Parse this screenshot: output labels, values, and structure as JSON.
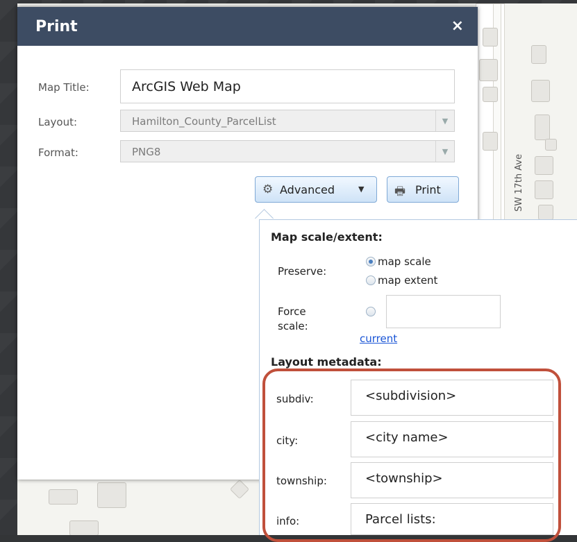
{
  "map": {
    "street_label": "SW 17th Ave"
  },
  "dialog": {
    "title": "Print",
    "close_glyph": "×",
    "map_title": {
      "label": "Map Title:",
      "value": "ArcGIS Web Map"
    },
    "layout": {
      "label": "Layout:",
      "value": "Hamilton_County_ParcelList"
    },
    "format": {
      "label": "Format:",
      "value": "PNG8"
    },
    "buttons": {
      "advanced": "Advanced",
      "print": "Print"
    }
  },
  "advanced_panel": {
    "scale_section": "Map scale/extent:",
    "preserve_label": "Preserve:",
    "preserve_options": [
      "map scale",
      "map extent"
    ],
    "preserve_selected": "map scale",
    "force_scale_label_line1": "Force",
    "force_scale_label_line2": "scale:",
    "force_scale_value": "",
    "current_link": "current",
    "metadata_section": "Layout metadata:",
    "metadata": [
      {
        "label": "subdiv:",
        "value": "<subdivision>"
      },
      {
        "label": "city:",
        "value": "<city name>"
      },
      {
        "label": "township:",
        "value": "<township>"
      },
      {
        "label": "info:",
        "value": "Parcel lists:"
      }
    ]
  },
  "colors": {
    "titlebar": "#3d4c63",
    "highlight": "#c0503b",
    "link": "#1a55d6"
  },
  "icons": {
    "close": "close-icon",
    "advanced": "gear-icon",
    "advanced_dropdown": "chevron-down-icon",
    "print": "printer-icon",
    "dropdown": "dropdown-arrow-icon"
  }
}
